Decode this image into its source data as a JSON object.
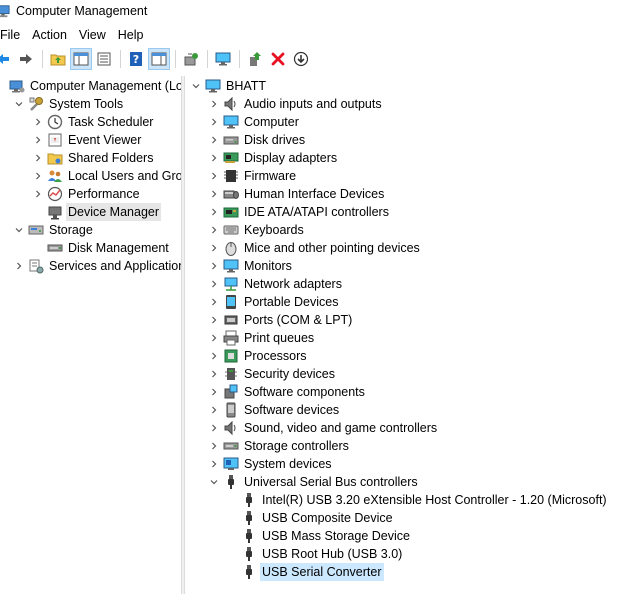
{
  "window": {
    "title": "Computer Management"
  },
  "menu": [
    "File",
    "Action",
    "View",
    "Help"
  ],
  "toolbar": [
    {
      "name": "back-button",
      "icon": "back-arrow-icon"
    },
    {
      "name": "forward-button",
      "icon": "forward-arrow-icon"
    },
    {
      "name": "up-one-level-button",
      "icon": "folder-up-icon"
    },
    {
      "name": "show-hide-console-tree-button",
      "icon": "console-tree-icon"
    },
    {
      "name": "properties-button",
      "icon": "properties-icon"
    },
    {
      "name": "help-button",
      "icon": "help-icon"
    },
    {
      "name": "show-hide-action-pane-button",
      "icon": "action-pane-icon"
    },
    {
      "name": "scan-hardware-button",
      "icon": "scan-hardware-icon"
    },
    {
      "name": "display-device-button",
      "icon": "monitor-icon"
    },
    {
      "name": "update-driver-button",
      "icon": "update-driver-icon"
    },
    {
      "name": "uninstall-device-button",
      "icon": "red-x-icon"
    },
    {
      "name": "disable-device-button",
      "icon": "download-circle-icon"
    }
  ],
  "left_tree": [
    {
      "label": "Computer Management (Local",
      "level": 0,
      "chevron": "none",
      "icon": "computer-management-icon"
    },
    {
      "label": "System Tools",
      "level": 1,
      "chevron": "down",
      "icon": "system-tools-icon"
    },
    {
      "label": "Task Scheduler",
      "level": 2,
      "chevron": "right",
      "icon": "clock-icon"
    },
    {
      "label": "Event Viewer",
      "level": 2,
      "chevron": "right",
      "icon": "event-viewer-icon"
    },
    {
      "label": "Shared Folders",
      "level": 2,
      "chevron": "right",
      "icon": "shared-folder-icon"
    },
    {
      "label": "Local Users and Groups",
      "level": 2,
      "chevron": "right",
      "icon": "users-icon"
    },
    {
      "label": "Performance",
      "level": 2,
      "chevron": "right",
      "icon": "performance-icon"
    },
    {
      "label": "Device Manager",
      "level": 2,
      "chevron": "none",
      "icon": "device-manager-icon",
      "selected": true
    },
    {
      "label": "Storage",
      "level": 1,
      "chevron": "down",
      "icon": "storage-icon"
    },
    {
      "label": "Disk Management",
      "level": 2,
      "chevron": "none",
      "icon": "disk-management-icon"
    },
    {
      "label": "Services and Applications",
      "level": 1,
      "chevron": "right",
      "icon": "services-icon"
    }
  ],
  "right_tree": [
    {
      "label": "BHATT",
      "level": 0,
      "chevron": "down",
      "icon": "computer-small-icon"
    },
    {
      "label": "Audio inputs and outputs",
      "level": 1,
      "chevron": "right",
      "icon": "speaker-icon"
    },
    {
      "label": "Computer",
      "level": 1,
      "chevron": "right",
      "icon": "monitor-icon"
    },
    {
      "label": "Disk drives",
      "level": 1,
      "chevron": "right",
      "icon": "disk-drive-icon"
    },
    {
      "label": "Display adapters",
      "level": 1,
      "chevron": "right",
      "icon": "display-adapter-icon"
    },
    {
      "label": "Firmware",
      "level": 1,
      "chevron": "right",
      "icon": "firmware-icon"
    },
    {
      "label": "Human Interface Devices",
      "level": 1,
      "chevron": "right",
      "icon": "hid-icon"
    },
    {
      "label": "IDE ATA/ATAPI controllers",
      "level": 1,
      "chevron": "right",
      "icon": "ide-controller-icon"
    },
    {
      "label": "Keyboards",
      "level": 1,
      "chevron": "right",
      "icon": "keyboard-icon"
    },
    {
      "label": "Mice and other pointing devices",
      "level": 1,
      "chevron": "right",
      "icon": "mouse-icon"
    },
    {
      "label": "Monitors",
      "level": 1,
      "chevron": "right",
      "icon": "monitor-icon"
    },
    {
      "label": "Network adapters",
      "level": 1,
      "chevron": "right",
      "icon": "network-adapter-icon"
    },
    {
      "label": "Portable Devices",
      "level": 1,
      "chevron": "right",
      "icon": "portable-device-icon"
    },
    {
      "label": "Ports (COM & LPT)",
      "level": 1,
      "chevron": "right",
      "icon": "port-icon"
    },
    {
      "label": "Print queues",
      "level": 1,
      "chevron": "right",
      "icon": "printer-icon"
    },
    {
      "label": "Processors",
      "level": 1,
      "chevron": "right",
      "icon": "processor-icon"
    },
    {
      "label": "Security devices",
      "level": 1,
      "chevron": "right",
      "icon": "security-device-icon"
    },
    {
      "label": "Software components",
      "level": 1,
      "chevron": "right",
      "icon": "software-component-icon"
    },
    {
      "label": "Software devices",
      "level": 1,
      "chevron": "right",
      "icon": "software-device-icon"
    },
    {
      "label": "Sound, video and game controllers",
      "level": 1,
      "chevron": "right",
      "icon": "speaker-icon"
    },
    {
      "label": "Storage controllers",
      "level": 1,
      "chevron": "right",
      "icon": "storage-controller-icon"
    },
    {
      "label": "System devices",
      "level": 1,
      "chevron": "right",
      "icon": "system-device-icon"
    },
    {
      "label": "Universal Serial Bus controllers",
      "level": 1,
      "chevron": "down",
      "icon": "usb-icon"
    },
    {
      "label": "Intel(R) USB 3.20 eXtensible Host Controller - 1.20 (Microsoft)",
      "level": 2,
      "chevron": "none",
      "icon": "usb-icon"
    },
    {
      "label": "USB Composite Device",
      "level": 2,
      "chevron": "none",
      "icon": "usb-icon"
    },
    {
      "label": "USB Mass Storage Device",
      "level": 2,
      "chevron": "none",
      "icon": "usb-icon"
    },
    {
      "label": "USB Root Hub (USB 3.0)",
      "level": 2,
      "chevron": "none",
      "icon": "usb-icon"
    },
    {
      "label": "USB Serial Converter",
      "level": 2,
      "chevron": "none",
      "icon": "usb-icon",
      "selected": true
    }
  ],
  "colors": {
    "selection_blue": "#cce8ff",
    "selection_gray": "#e6e6e6",
    "accent_blue": "#1e88e5",
    "danger_red": "#e81123"
  }
}
